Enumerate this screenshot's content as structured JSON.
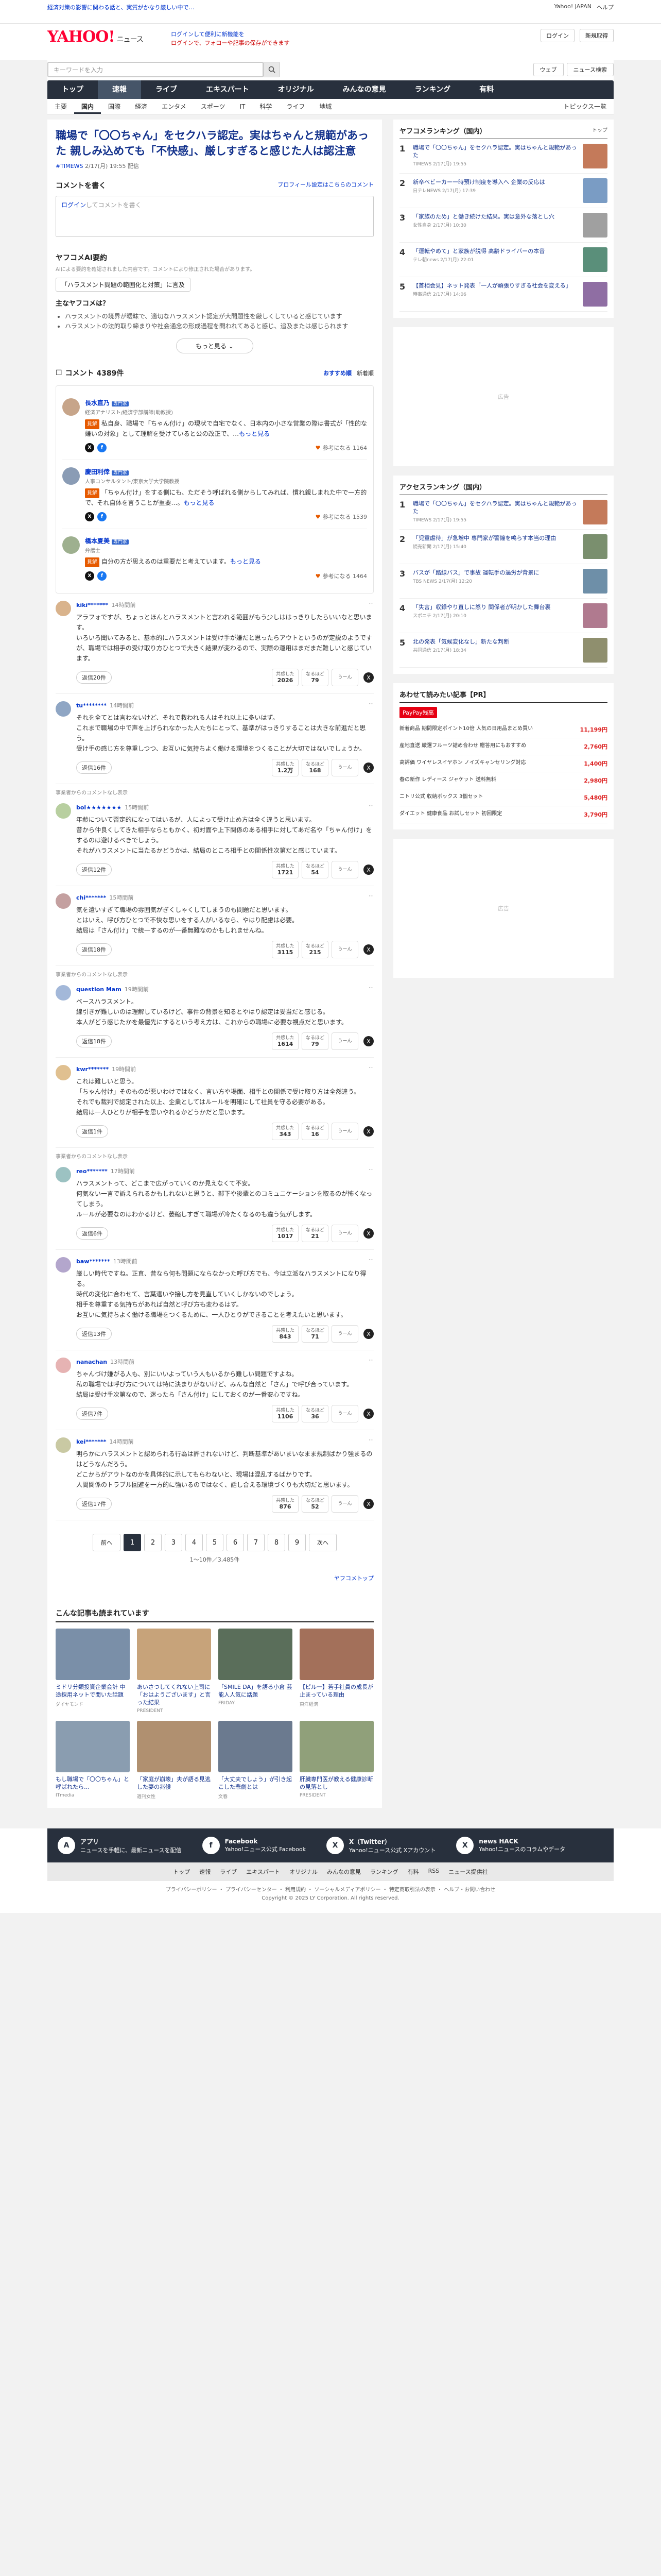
{
  "topbar": {
    "promo": "経済対策の影響に関わる話と、実質がかなり厳しい中で…",
    "links": [
      "Yahoo! JAPAN",
      "ヘルプ"
    ]
  },
  "header": {
    "logo": "YAHOO!",
    "logo_sub": "ニュース",
    "notice_1": "ログインして便利に新機能を",
    "notice_2": "ログインで、フォローや記事の保存ができます",
    "login": "ログイン",
    "signup": "新規取得"
  },
  "search": {
    "placeholder": "キーワードを入力",
    "web_label": "ウェブ",
    "news_label": "ニュース検索"
  },
  "gnav": {
    "items": [
      "トップ",
      "速報",
      "ライブ",
      "エキスパート",
      "オリジナル",
      "みんなの意見",
      "ランキング",
      "有料"
    ],
    "active": 1,
    "right": "有料"
  },
  "subnav": {
    "items": [
      "主要",
      "国内",
      "国際",
      "経済",
      "エンタメ",
      "スポーツ",
      "IT",
      "科学",
      "ライフ",
      "地域"
    ],
    "active": 1,
    "more": "トピックス一覧"
  },
  "article": {
    "title": "職場で「〇〇ちゃん」をセクハラ認定。実はちゃんと規範があった 親しみ込めても「不快感」、厳しすぎると感じた人は認注意",
    "source": "#TIMEWS",
    "date": "2/17(月) 19:55 配信"
  },
  "comment_write": {
    "heading": "コメントを書く",
    "policy": "プロフィール設定はこちらのコメント",
    "login_text": "ログイン",
    "placeholder": "してコメントを書く"
  },
  "ai_summary": {
    "heading": "ヤフコメAI要約",
    "note": "AIによる要約を確認されました内容です。コメントにより修正された場合があります。",
    "chip": "「ハラスメント問題の範囲化と対策」に言及",
    "question": "主なヤフコメは？",
    "points": [
      "ハラスメントの境界が曖昧で、適切なハラスメント認定が大問題性を厳しくしていると感じています",
      "ハラスメントの法的取り締まりや社会通念の形成過程を問われてあると感じ、追及または感じられます"
    ],
    "more": "もっと見る"
  },
  "comments_header": {
    "title": "コメント 4389件",
    "sort_recommend": "おすすめ順",
    "sort_new": "新着順"
  },
  "experts": [
    {
      "name": "長水直乃",
      "badge": "専門家",
      "role": "経済アナリスト/経済学部講師(助教授)",
      "tag": "見解",
      "text": "私自身、職場で「ちゃん付け」の現状で自宅でなく、日本内の小さな営業の際は書式が「性的な嫌いの対象」として理解を受けていると公の改正で、…",
      "more": "もっと見る",
      "reaction": "参考になる 1164"
    },
    {
      "name": "慶田利倖",
      "badge": "専門家",
      "role": "人事コンサルタント/東京大学大学院教授",
      "tag": "見解",
      "text": "「ちゃん付け」をする側にも、ただそう呼ばれる側からしてみれば、慣れ親しまれた中で一方的で、それ自体を言うことが重要…。",
      "more": "もっと見る",
      "reaction": "参考になる 1539"
    },
    {
      "name": "橋本夏美",
      "badge": "専門家",
      "role": "弁護士",
      "tag": "見解",
      "text": "自分の方が思えるのは重要だと考えています。",
      "more": "もっと見る",
      "reaction": "参考になる 1464"
    }
  ],
  "comments": [
    {
      "user": "kiki*******",
      "time": "14時間前",
      "text": "アラフォですが、ちょっとほんとハラスメントと言われる範囲がもう少しははっきりしたらいいなと思います。\nいろいろ聞いてみると、基本的にハラスメントは受け手が嫌だと思ったらアウトというのが定説のようですが、職場では相手の受け取り方ひとつで大きく結果が変わるので、実際の運用はまだまだ難しいと感じています。",
      "upvote": "2026",
      "downvote": "79",
      "replies": "返信20件",
      "color": "#d9b38c"
    },
    {
      "user": "tu********",
      "time": "14時間前",
      "text": "それを全てとは言わないけど、それで救われる人はそれ以上に多いはず。\nこれまで職場の中で声を上げられなかった人たちにとって、基準がはっきりすることは大きな前進だと思う。\n受け手の感じ方を尊重しつつ、お互いに気持ちよく働ける環境をつくることが大切ではないでしょうか。",
      "upvote": "1.2万",
      "downvote": "168",
      "replies": "返信16件",
      "color": "#8fa6c4"
    },
    {
      "user": "bol★★★★★★★",
      "time": "15時間前",
      "text": "年齢について否定的になってはいるが、人によって受け止め方は全く違うと思います。\n昔から仲良くしてきた相手ならともかく、初対面や上下関係のある相手に対してあだ名や「ちゃん付け」をするのは避けるべきでしょう。\nそれがハラスメントに当たるかどうかは、結局のところ相手との関係性次第だと感じています。",
      "upvote": "1721",
      "downvote": "54",
      "replies": "返信12件",
      "color": "#b8cfa0"
    },
    {
      "user": "chi*******",
      "time": "15時間前",
      "text": "気を遣いすぎて職場の雰囲気がぎくしゃくしてしまうのも問題だと思います。\nとはいえ、呼び方ひとつで不快な思いをする人がいるなら、やはり配慮は必要。\n結局は「さん付け」で統一するのが一番無難なのかもしれませんね。",
      "upvote": "3115",
      "downvote": "215",
      "replies": "返信18件",
      "color": "#c4a0a0"
    },
    {
      "user": "question Mam",
      "time": "19時間前",
      "text": "ベースハラスメント。\n線引きが難しいのは理解しているけど、事件の背景を知るとやはり認定は妥当だと感じる。\n本人がどう感じたかを最優先にするという考え方は、これからの職場に必要な視点だと思います。",
      "upvote": "1614",
      "downvote": "79",
      "replies": "返信18件",
      "color": "#a3b8d9"
    },
    {
      "user": "kwr*******",
      "time": "19時間前",
      "text": "これは難しいと思う。\n「ちゃん付け」そのものが悪いわけではなく、言い方や場面、相手との関係で受け取り方は全然違う。\nそれでも裁判で認定された以上、企業としてはルールを明確にして社員を守る必要がある。\n結局は一人ひとりが相手を思いやれるかどうかだと思います。",
      "upvote": "343",
      "downvote": "16",
      "replies": "返信1件",
      "color": "#e0c090"
    },
    {
      "user": "reo*******",
      "time": "17時間前",
      "text": "ハラスメントって、どこまで広がっていくのか見えなくて不安。\n何気ない一言で訴えられるかもしれないと思うと、部下や後輩とのコミュニケーションを取るのが怖くなってしまう。\nルールが必要なのはわかるけど、萎縮しすぎて職場が冷たくなるのも違う気がします。",
      "upvote": "1017",
      "downvote": "21",
      "replies": "返信6件",
      "color": "#9cc2c2"
    },
    {
      "user": "baw*******",
      "time": "13時間前",
      "text": "厳しい時代ですね。正直、昔なら何も問題にならなかった呼び方でも、今は立派なハラスメントになり得る。\n時代の変化に合わせて、言葉遣いや接し方を見直していくしかないのでしょう。\n相手を尊重する気持ちがあれば自然と呼び方も変わるはず。\nお互いに気持ちよく働ける職場をつくるために、一人ひとりができることを考えたいと思います。",
      "upvote": "843",
      "downvote": "71",
      "replies": "返信13件",
      "color": "#b3a6cc"
    },
    {
      "user": "nanachan",
      "time": "13時間前",
      "text": "ちゃんづけ嫌がる人も、別にいいよっていう人もいるから難しい問題ですよね。\n私の職場では呼び方については特に決まりがないけど、みんな自然と「さん」で呼び合っています。\n結局は受け手次第なので、迷ったら「さん付け」にしておくのが一番安心ですね。",
      "upvote": "1106",
      "downvote": "36",
      "replies": "返信7件",
      "color": "#e6b3b3"
    },
    {
      "user": "kei*******",
      "time": "14時間前",
      "text": "明らかにハラスメントと認められる行為は許されないけど、判断基準があいまいなまま規制ばかり強まるのはどうなんだろう。\nどこからがアウトなのかを具体的に示してもらわないと、現場は混乱するばかりです。\n人間関係のトラブル回避を一方的に強いるのではなく、話し合える環境づくりも大切だと思います。",
      "upvote": "876",
      "downvote": "52",
      "replies": "返信17件",
      "color": "#c9c9a3"
    }
  ],
  "reply_labels": {
    "upvote": "共感した",
    "downvote": "なるほど",
    "other": "うーん"
  },
  "pr_note": "事業者からのコメントなし表示",
  "pager": {
    "prev": "前へ",
    "next": "次へ",
    "pages": [
      "1",
      "2",
      "3",
      "4",
      "5",
      "6",
      "7",
      "8",
      "9"
    ],
    "info": "1〜10件／3,485件"
  },
  "footer_right": "ヤフコメトップ",
  "recommend": {
    "heading": "こんな記事も読まれています",
    "items": [
      {
        "title": "ミドリ分類投資企業会計 中途採用ネットで聞いた話題",
        "src": "ダイヤモンド",
        "color": "#7a8fa8"
      },
      {
        "title": "あいさつしてくれない上司に「おはようございます」と言った結果",
        "src": "PRESIDENT",
        "color": "#c7a37a"
      },
      {
        "title": "「SMILE DA」を語る小倉 芸能人人気に話題",
        "src": "FRIDAY",
        "color": "#5a6e5a"
      },
      {
        "title": "【ピル一】若手社員の成長が止まっている理由",
        "src": "東洋経済",
        "color": "#a3705a"
      },
      {
        "title": "もし職場で「〇〇ちゃん」と呼ばれたら…",
        "src": "ITmedia",
        "color": "#8a9db0"
      },
      {
        "title": "「家庭が崩壊」夫が語る見逃した妻の兆候",
        "src": "週刊女性",
        "color": "#b09070"
      },
      {
        "title": "「大丈夫でしょう」が引き起こした悲劇とは",
        "src": "文春",
        "color": "#6b7a8f"
      },
      {
        "title": "肝臓専門医が教える健康診断の見落とし",
        "src": "PRESIDENT",
        "color": "#90a07a"
      }
    ]
  },
  "side": {
    "ranking_title": "ヤフコメランキング（国内）",
    "ranking_x": "トップ",
    "ranking": [
      {
        "num": "1",
        "title": "職場で「〇〇ちゃん」をセクハラ認定。実はちゃんと規範があった",
        "src": "TIMEWS 2/17(月) 19:55",
        "color": "#c47a5a"
      },
      {
        "num": "2",
        "title": "新卒ベビーカー一時預け制度を導入へ 企業の反応は",
        "src": "日テレNEWS 2/17(月) 17:39",
        "color": "#7a9cc4"
      },
      {
        "num": "3",
        "title": "「家族のため」と働き続けた結果。実は意外な落とし穴",
        "src": "女性自身 2/17(月) 10:30",
        "color": "#a0a0a0"
      },
      {
        "num": "4",
        "title": "「運転やめて」と家族が説得 高齢ドライバーの本音",
        "src": "テレ朝news 2/17(月) 22:01",
        "color": "#5a8f7a"
      },
      {
        "num": "5",
        "title": "【首相会見】ネット発表「一人が頑張りすぎる社会を変える」",
        "src": "時事通信 2/17(月) 14:06",
        "color": "#8f6ea3"
      }
    ],
    "access_title": "アクセスランキング（国内）",
    "access": [
      {
        "num": "1",
        "title": "職場で「〇〇ちゃん」をセクハラ認定。実はちゃんと規範があった",
        "src": "TIMEWS 2/17(月) 19:55",
        "color": "#c47a5a"
      },
      {
        "num": "2",
        "title": "「児童虐待」が急増中 専門家が警鐘を鳴らす本当の理由",
        "src": "読売新聞 2/17(月) 15:40",
        "color": "#7a8f6e"
      },
      {
        "num": "3",
        "title": "バスが「路線バス」で事故 運転手の過労が背景に",
        "src": "TBS NEWS 2/17(月) 12:20",
        "color": "#6e8fa8"
      },
      {
        "num": "4",
        "title": "「失言」収録やり直しに怒り 関係者が明かした舞台裏",
        "src": "スポニチ 2/17(月) 20:10",
        "color": "#b07a8f"
      },
      {
        "num": "5",
        "title": "北の発表「気候変化なし」新たな判断",
        "src": "共同通信 2/17(月) 18:34",
        "color": "#8f8f6e"
      }
    ],
    "shopping_title": "あわせて読みたい記事【PR】",
    "pay_label": "PayPay残高",
    "shopping": [
      {
        "title": "新着商品 期間限定ポイント10倍 人気の日用品まとめ買い",
        "price": "11,199円"
      },
      {
        "title": "産地直送 厳選フルーツ詰め合わせ 贈答用にもおすすめ",
        "price": "2,760円"
      },
      {
        "title": "高評価 ワイヤレスイヤホン ノイズキャンセリング対応",
        "price": "1,400円"
      },
      {
        "title": "春の新作 レディース ジャケット 送料無料",
        "price": "2,980円"
      },
      {
        "title": "ニトリ公式 収納ボックス 3個セット",
        "price": "5,480円"
      },
      {
        "title": "ダイエット 健康食品 お試しセット 初回限定",
        "price": "3,790円"
      }
    ],
    "ad_label": "広告"
  },
  "footer": {
    "share": [
      {
        "icon": "A",
        "title": "アプリ",
        "desc": "ニュースを手軽に、最新ニュースを配信"
      },
      {
        "icon": "f",
        "title": "Facebook",
        "desc": "Yahoo!ニュース公式 Facebook"
      },
      {
        "icon": "X",
        "title": "X（Twitter）",
        "desc": "Yahoo!ニュース公式 Xアカウント"
      },
      {
        "icon": "X",
        "title": "news HACK",
        "desc": "Yahoo!ニュースのコラムやデータ"
      }
    ],
    "nav": [
      "トップ",
      "速報",
      "ライブ",
      "エキスパート",
      "オリジナル",
      "みんなの意見",
      "ランキング",
      "有料",
      "RSS",
      "ニュース提供社"
    ],
    "legal_1": "プライバシーポリシー ・ プライバシーセンター ・ 利用規約 ・ ソーシャルメディアポリシー ・ 特定商取引法の表示 ・ ヘルプ・お問い合わせ",
    "legal_2": "Copyright © 2025 LY Corporation. All rights reserved."
  }
}
